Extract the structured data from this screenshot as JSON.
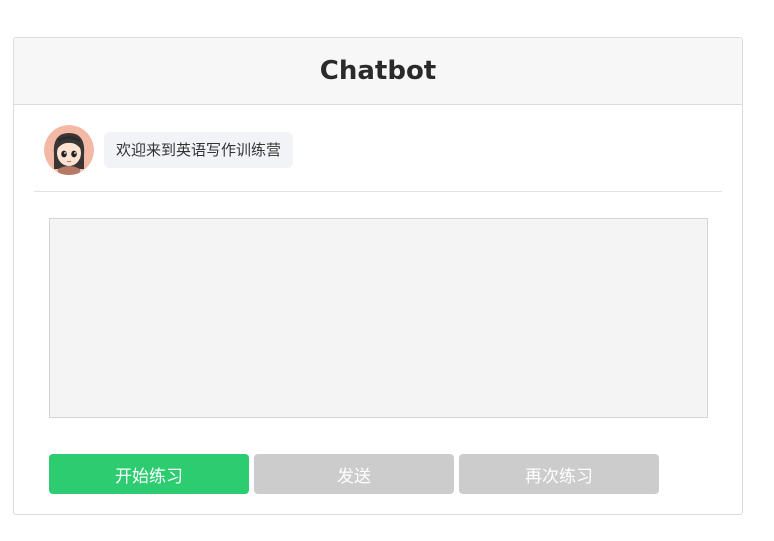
{
  "header": {
    "title": "Chatbot"
  },
  "messages": [
    {
      "sender": "bot",
      "avatar": "girl-avatar-icon",
      "text": "欢迎来到英语写作训练营"
    }
  ],
  "input": {
    "value": "",
    "placeholder": ""
  },
  "buttons": {
    "start_label": "开始练习",
    "send_label": "发送",
    "retry_label": "再次练习"
  },
  "colors": {
    "primary": "#2ecc71",
    "disabled": "#cccccc",
    "bubble": "#f2f3f7",
    "header_bg": "#f7f7f7"
  }
}
